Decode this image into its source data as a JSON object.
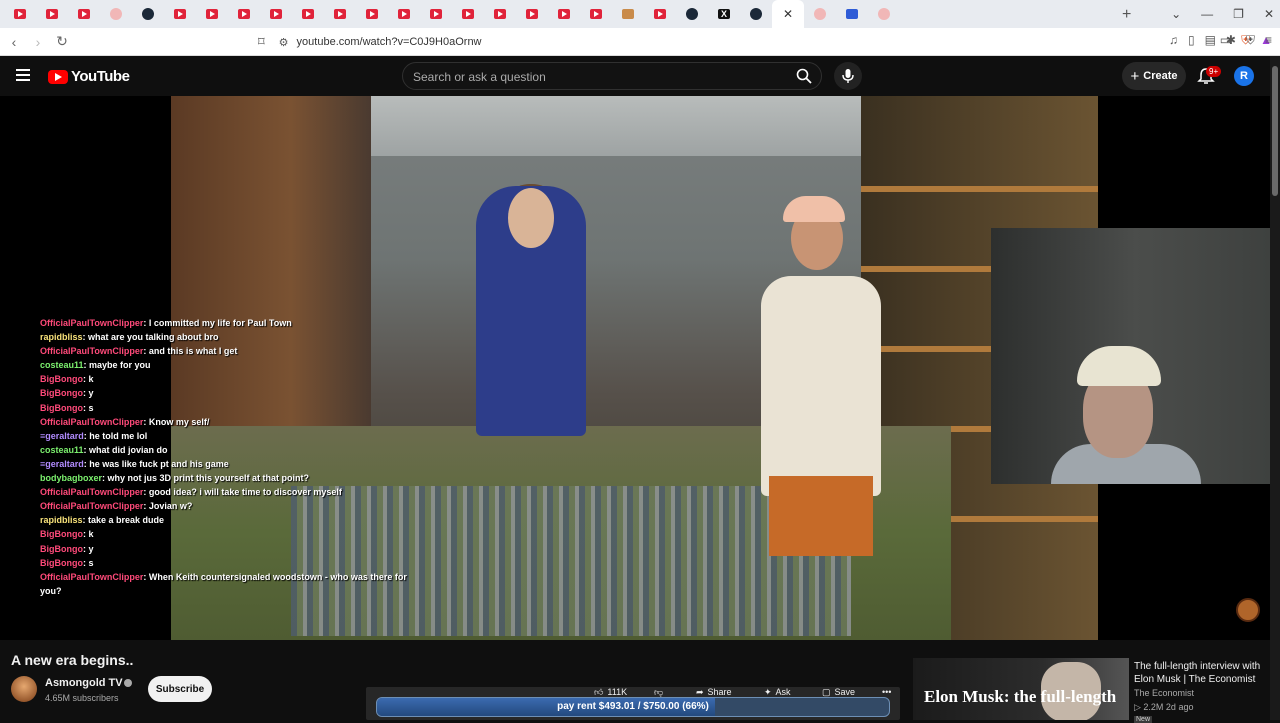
{
  "browser": {
    "tabs": [
      {
        "icon": "youtube-icon"
      },
      {
        "icon": "youtube-icon"
      },
      {
        "icon": "youtube-icon"
      },
      {
        "icon": "reddit-icon"
      },
      {
        "icon": "steam-icon"
      },
      {
        "icon": "youtube-icon"
      },
      {
        "icon": "youtube-icon"
      },
      {
        "icon": "youtube-icon"
      },
      {
        "icon": "youtube-icon"
      },
      {
        "icon": "youtube-icon"
      },
      {
        "icon": "youtube-icon"
      },
      {
        "icon": "youtube-icon"
      },
      {
        "icon": "youtube-icon"
      },
      {
        "icon": "youtube-icon"
      },
      {
        "icon": "youtube-icon"
      },
      {
        "icon": "youtube-icon"
      },
      {
        "icon": "youtube-icon"
      },
      {
        "icon": "youtube-icon"
      },
      {
        "icon": "youtube-icon"
      },
      {
        "icon": "misc-icon"
      },
      {
        "icon": "youtube-icon"
      },
      {
        "icon": "steam-icon"
      },
      {
        "icon": "x-icon"
      },
      {
        "icon": "steam-icon"
      },
      {
        "icon": "active-tab"
      },
      {
        "icon": "pink-icon"
      },
      {
        "icon": "blue-icon"
      },
      {
        "icon": "pink-icon"
      }
    ],
    "close_label": "✕",
    "url": "youtube.com/watch?v=C0J9H0aOrnw"
  },
  "header": {
    "logo_text": "YouTube",
    "search_placeholder": "Search or ask a question",
    "create_label": "Create",
    "notif_badge": "9+",
    "avatar_letter": "R"
  },
  "chat": [
    {
      "user": "OfficialPaulTownClipper",
      "color": "#ff4a7a",
      "text": "I committed my life for Paul Town"
    },
    {
      "user": "rapidbliss",
      "color": "#f8e27a",
      "text": "what are you talking about bro"
    },
    {
      "user": "OfficialPaulTownClipper",
      "color": "#ff4a7a",
      "text": "and this is what I get"
    },
    {
      "user": "costeau11",
      "color": "#7cf06e",
      "text": "maybe for you"
    },
    {
      "user": "BigBongo",
      "color": "#ff4a7a",
      "text": "k"
    },
    {
      "user": "BigBongo",
      "color": "#ff4a7a",
      "text": "y"
    },
    {
      "user": "BigBongo",
      "color": "#ff4a7a",
      "text": "s"
    },
    {
      "user": "OfficialPaulTownClipper",
      "color": "#ff4a7a",
      "text": "Know my self/"
    },
    {
      "user": "≡geraltard",
      "color": "#b28cff",
      "text": "he told me lol"
    },
    {
      "user": "costeau11",
      "color": "#7cf06e",
      "text": "what did jovian do"
    },
    {
      "user": "≡geraltard",
      "color": "#b28cff",
      "text": "he was like fuck pt and his game"
    },
    {
      "user": "bodybagboxer",
      "color": "#7cf06e",
      "text": "why not jus 3D print this yourself at that point?"
    },
    {
      "user": "OfficialPaulTownClipper",
      "color": "#ff4a7a",
      "text": "good idea? i will take time to discover myself"
    },
    {
      "user": "OfficialPaulTownClipper",
      "color": "#ff4a7a",
      "text": "Jovian w?"
    },
    {
      "user": "rapidbliss",
      "color": "#f8e27a",
      "text": "take a break dude"
    },
    {
      "user": "BigBongo",
      "color": "#ff4a7a",
      "text": "k"
    },
    {
      "user": "BigBongo",
      "color": "#ff4a7a",
      "text": "y"
    },
    {
      "user": "BigBongo",
      "color": "#ff4a7a",
      "text": "s"
    },
    {
      "user": "OfficialPaulTownClipper",
      "color": "#ff4a7a",
      "text": "When Keith countersignaled woodstown - who was there for you?"
    }
  ],
  "video": {
    "title": "A new era begins..",
    "channel": "Asmongold TV",
    "subscribers": "4.65M subscribers",
    "subscribe_label": "Subscribe",
    "likes": "111K",
    "share_label": "Share",
    "ask_label": "Ask",
    "save_label": "Save",
    "more_label": "•••"
  },
  "goal": {
    "text": "pay rent $493.01 / $750.00 (66%)",
    "fraction": 0.66
  },
  "recommendation": {
    "thumb_text": "Elon Musk: the full-length",
    "title": "The full-length interview with Elon Musk | The Economist",
    "channel": "The Economist",
    "meta": "▷ 2.2M   2d ago",
    "new_label": "New"
  }
}
